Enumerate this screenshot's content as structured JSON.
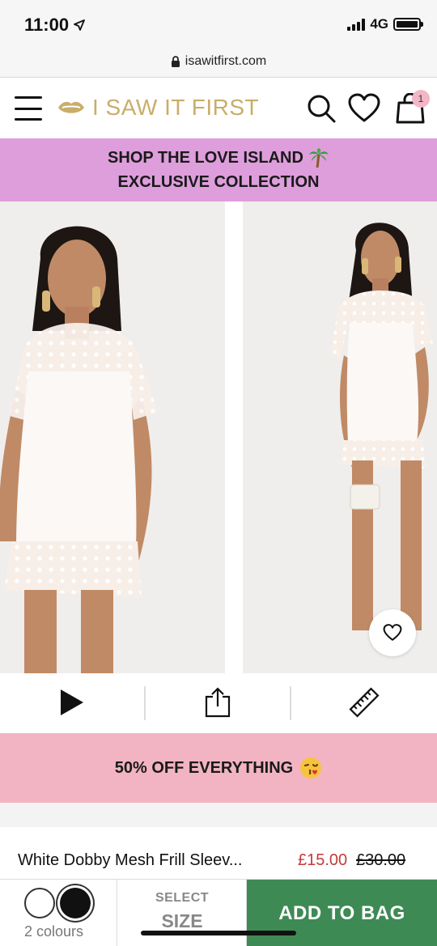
{
  "status_bar": {
    "time": "11:00",
    "network": "4G"
  },
  "browser": {
    "url": "isawitfirst.com"
  },
  "header": {
    "logo_text": "I SAW IT FIRST",
    "bag_count": "1"
  },
  "promo": {
    "line1": "SHOP THE LOVE ISLAND",
    "line2": "EXCLUSIVE COLLECTION"
  },
  "sale_banner": {
    "text": "50% OFF EVERYTHING"
  },
  "product": {
    "name": "White Dobby Mesh Frill Sleev...",
    "price_now": "£15.00",
    "price_was": "£30.00"
  },
  "bottom_bar": {
    "colours_label": "2 colours",
    "size_line1": "SELECT",
    "size_line2": "SIZE",
    "add_label": "ADD TO BAG"
  },
  "colors": {
    "brand_gold": "#c9ad6a",
    "promo_pink": "#de9edc",
    "sale_pink": "#f2b4c2",
    "sale_red": "#c33a3a",
    "cta_green": "#3e8a55"
  },
  "icons": [
    "location-arrow-icon",
    "lock-icon",
    "menu-icon",
    "lips-icon",
    "search-icon",
    "heart-icon",
    "shopping-bag-icon",
    "palm-tree-icon",
    "play-icon",
    "share-icon",
    "ruler-icon",
    "kiss-emoji-icon"
  ]
}
